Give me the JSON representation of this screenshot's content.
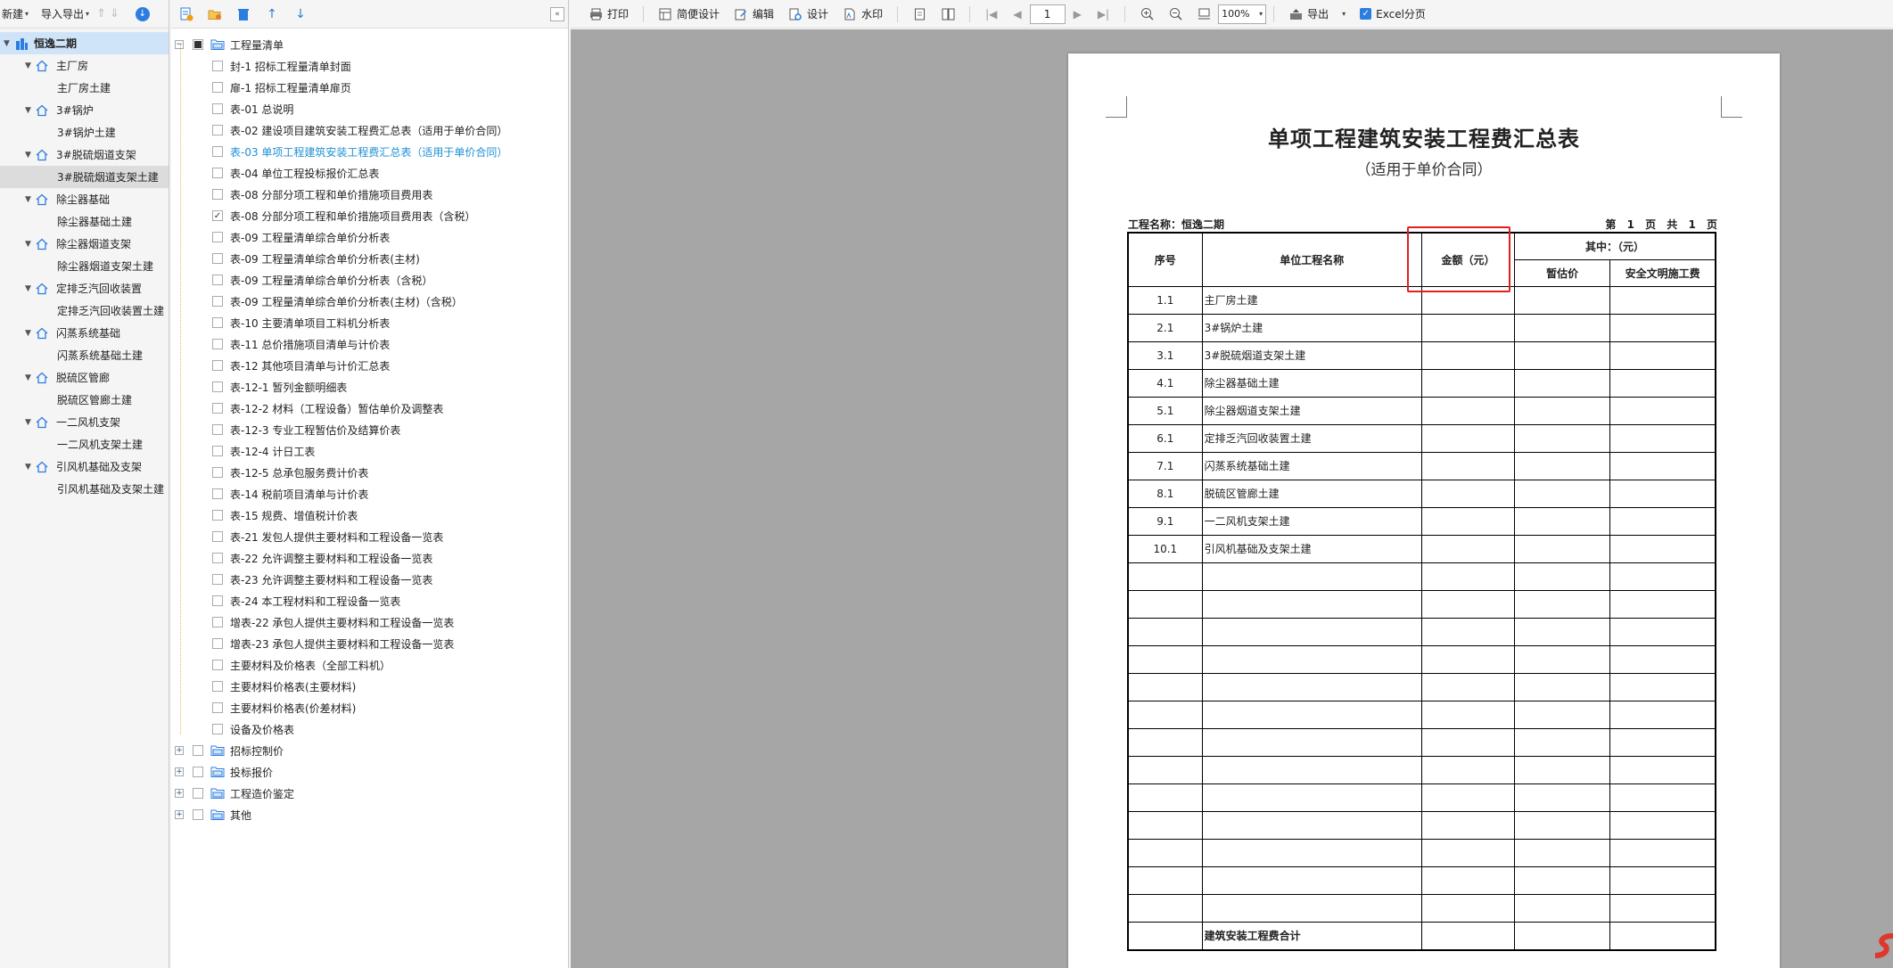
{
  "left_toolbar": {
    "new_label": "新建",
    "import_export_label": "导入导出"
  },
  "project_tree": {
    "root": "恒逸二期",
    "items": [
      {
        "name": "主厂房",
        "child": "主厂房土建"
      },
      {
        "name": "3#锅炉",
        "child": "3#锅炉土建"
      },
      {
        "name": "3#脱硫烟道支架",
        "child": "3#脱硫烟道支架土建"
      },
      {
        "name": "除尘器基础",
        "child": "除尘器基础土建"
      },
      {
        "name": "除尘器烟道支架",
        "child": "除尘器烟道支架土建"
      },
      {
        "name": "定排乏汽回收装置",
        "child": "定排乏汽回收装置土建"
      },
      {
        "name": "闪蒸系统基础",
        "child": "闪蒸系统基础土建"
      },
      {
        "name": "脱硫区管廊",
        "child": "脱硫区管廊土建"
      },
      {
        "name": "一二风机支架",
        "child": "一二风机支架土建"
      },
      {
        "name": "引风机基础及支架",
        "child": "引风机基础及支架土建"
      }
    ],
    "selected_child": "3#脱硫烟道支架土建"
  },
  "report_tree": {
    "group_bill": "工程量清单",
    "items": [
      "封-1 招标工程量清单封面",
      "扉-1 招标工程量清单扉页",
      "表-01 总说明",
      "表-02 建设项目建筑安装工程费汇总表（适用于单价合同）",
      "表-03 单项工程建筑安装工程费汇总表（适用于单价合同）",
      "表-04 单位工程投标报价汇总表",
      "表-08 分部分项工程和单价措施项目费用表",
      "表-08 分部分项工程和单价措施项目费用表（含税）",
      "表-09 工程量清单综合单价分析表",
      "表-09 工程量清单综合单价分析表(主材)",
      "表-09 工程量清单综合单价分析表（含税）",
      "表-09 工程量清单综合单价分析表(主材)（含税）",
      "表-10 主要清单项目工料机分析表",
      "表-11 总价措施项目清单与计价表",
      "表-12 其他项目清单与计价汇总表",
      "表-12-1 暂列金额明细表",
      "表-12-2 材料（工程设备）暂估单价及调整表",
      "表-12-3 专业工程暂估价及结算价表",
      "表-12-4 计日工表",
      "表-12-5 总承包服务费计价表",
      "表-14 税前项目清单与计价表",
      "表-15 规费、增值税计价表",
      "表-21 发包人提供主要材料和工程设备一览表",
      "表-22 允许调整主要材料和工程设备一览表",
      "表-23 允许调整主要材料和工程设备一览表",
      "表-24 本工程材料和工程设备一览表",
      "增表-22 承包人提供主要材料和工程设备一览表",
      "增表-23 承包人提供主要材料和工程设备一览表",
      "主要材料及价格表（全部工料机）",
      "主要材料价格表(主要材料)",
      "主要材料价格表(价差材料)",
      "设备及价格表"
    ],
    "active_index": 4,
    "checked_index": 7,
    "other_groups": [
      "招标控制价",
      "投标报价",
      "工程造价鉴定",
      "其他"
    ]
  },
  "preview_toolbar": {
    "print": "打印",
    "simple_design": "简便设计",
    "edit": "编辑",
    "design": "设计",
    "watermark": "水印",
    "page_number": "1",
    "zoom": "100%",
    "export": "导出",
    "excel_paging": "Excel分页"
  },
  "report": {
    "title": "单项工程建筑安装工程费汇总表",
    "subtitle": "（适用于单价合同）",
    "project_name_line": "工程名称：恒逸二期",
    "page_line": "第 1 页 共 1 页",
    "headers": {
      "seq": "序号",
      "unit_name": "单位工程名称",
      "amount": "金额（元）",
      "of_which": "其中：（元）",
      "provisional": "暂估价",
      "safety": "安全文明施工费"
    },
    "rows": [
      {
        "seq": "1.1",
        "name": "主厂房土建"
      },
      {
        "seq": "2.1",
        "name": "3#锅炉土建"
      },
      {
        "seq": "3.1",
        "name": "3#脱硫烟道支架土建"
      },
      {
        "seq": "4.1",
        "name": "除尘器基础土建"
      },
      {
        "seq": "5.1",
        "name": "除尘器烟道支架土建"
      },
      {
        "seq": "6.1",
        "name": "定排乏汽回收装置土建"
      },
      {
        "seq": "7.1",
        "name": "闪蒸系统基础土建"
      },
      {
        "seq": "8.1",
        "name": "脱硫区管廊土建"
      },
      {
        "seq": "9.1",
        "name": "一二风机支架土建"
      },
      {
        "seq": "10.1",
        "name": "引风机基础及支架土建"
      }
    ],
    "empty_rows": 13,
    "total_label": "建筑安装工程费合计"
  },
  "colors": {
    "accent_blue": "#2b7de0",
    "active_link": "#1e8fd6",
    "highlight_red": "#e02020",
    "tree_root_bg": "#cfe4f9",
    "preview_bg": "#a6a6a6"
  },
  "icons": {
    "project_parent": "home-icon",
    "project_root": "building-icon",
    "report_group": "folder-icon"
  }
}
